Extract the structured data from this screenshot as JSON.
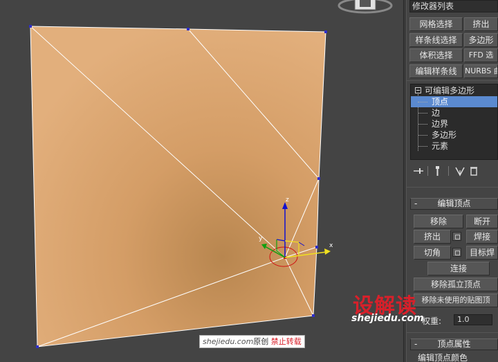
{
  "modifier_list": {
    "label": "修改器列表"
  },
  "modifier_buttons": [
    {
      "label": "网格选择"
    },
    {
      "label": "挤出"
    },
    {
      "label": "样条线选择"
    },
    {
      "label": "多边形"
    },
    {
      "label": "体积选择"
    },
    {
      "label": "FFD 选"
    },
    {
      "label": "编辑样条线"
    },
    {
      "label": "NURBS 曲"
    }
  ],
  "stack": {
    "root": "可编辑多边形",
    "items": [
      {
        "label": "顶点",
        "selected": true
      },
      {
        "label": "边",
        "selected": false
      },
      {
        "label": "边界",
        "selected": false
      },
      {
        "label": "多边形",
        "selected": false
      },
      {
        "label": "元素",
        "selected": false
      }
    ]
  },
  "stack_tools": {
    "pin_icon": "pin-stack-icon",
    "show_result_icon": "show-end-result-icon",
    "unique_icon": "make-unique-icon",
    "remove_icon": "remove-modifier-icon"
  },
  "edit_vertices": {
    "sign": "-",
    "title": "编辑顶点",
    "remove": "移除",
    "break": "断开",
    "extrude": "挤出",
    "weld": "焊接",
    "chamfer": "切角",
    "target_weld": "目标焊",
    "connect": "连接",
    "remove_isolated": "移除孤立顶点",
    "remove_unused_map": "移除未使用的贴图顶",
    "weight_label": "权重:",
    "weight_value": "1.0"
  },
  "vertex_properties": {
    "sign": "-",
    "title": "顶点属性",
    "edit_color": "编辑顶点颜色"
  },
  "gizmo": {
    "x_label": "x",
    "y_label": "y",
    "z_label": "z"
  },
  "watermark": {
    "logo": "设解读",
    "url": "shejiedu.com",
    "badge_url": "shejiedu.com",
    "badge_orig": "原创",
    "badge_no_repost": "禁止转载"
  },
  "colors": {
    "viewport_bg": "#444444",
    "mesh_fill": "#d9a36c",
    "mesh_fill_dark": "#bd8a55",
    "edge": "#ffffff",
    "vertex": "#2e2ec8",
    "selection": "#5b8ad0",
    "gizmo_x": "#d01010",
    "gizmo_y": "#10a010",
    "gizmo_z": "#1010d0",
    "gizmo_highlight": "#f0e020"
  }
}
